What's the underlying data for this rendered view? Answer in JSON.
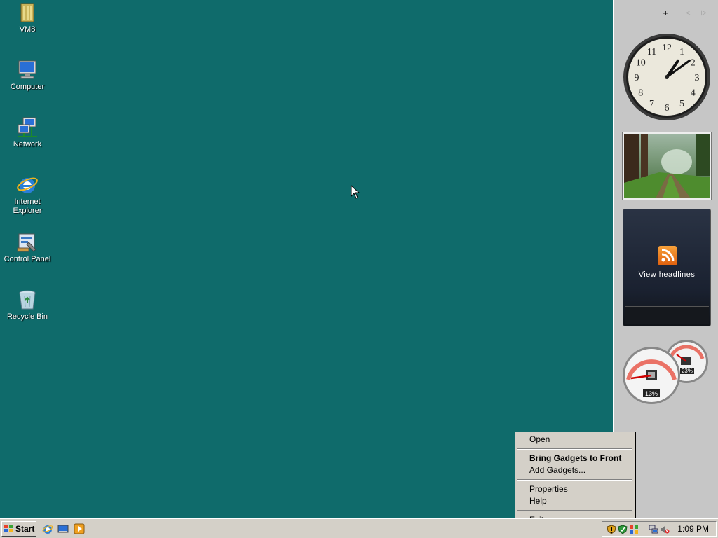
{
  "desktop": {
    "background_color": "#0f6b6b",
    "icons": [
      {
        "label": "VM8",
        "icon": "folder-icon"
      },
      {
        "label": "Computer",
        "icon": "computer-icon"
      },
      {
        "label": "Network",
        "icon": "network-icon"
      },
      {
        "label": "Internet Explorer",
        "icon": "internet-explorer-icon"
      },
      {
        "label": "Control Panel",
        "icon": "control-panel-icon"
      },
      {
        "label": "Recycle Bin",
        "icon": "recycle-bin-icon"
      }
    ]
  },
  "sidebar": {
    "add_gadget": "+",
    "prev_page": "◁",
    "next_page": "▷",
    "clock": {
      "numerals": [
        "12",
        "1",
        "2",
        "3",
        "4",
        "5",
        "6",
        "7",
        "8",
        "9",
        "10",
        "11"
      ],
      "time": "1:09"
    },
    "feed": {
      "label": "View headlines"
    },
    "meter": {
      "cpu": "13%",
      "memory": "23%"
    }
  },
  "context_menu": {
    "items": [
      "Open",
      "Bring Gadgets to Front",
      "Add Gadgets...",
      "Properties",
      "Help",
      "Exit"
    ]
  },
  "taskbar": {
    "start_label": "Start",
    "quick_launch": [
      "internet-explorer-icon",
      "show-desktop-icon",
      "media-player-icon"
    ],
    "time": "1:09 PM"
  }
}
